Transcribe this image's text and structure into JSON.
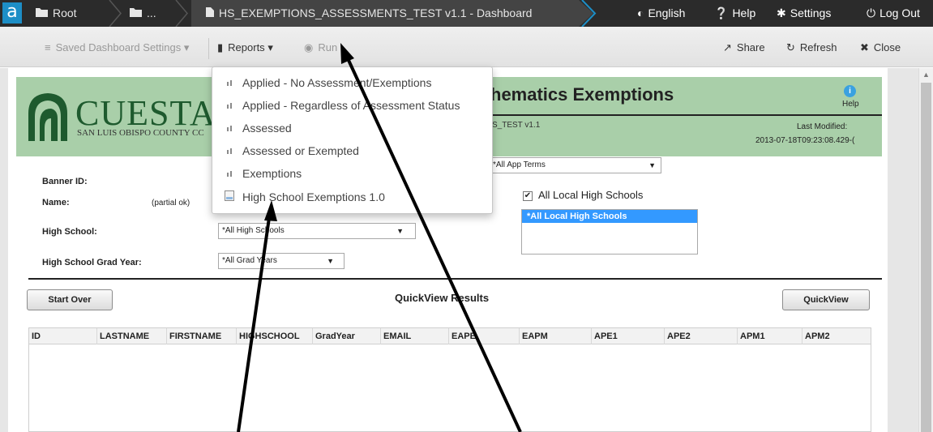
{
  "navbar": {
    "logo": "a",
    "breadcrumbs": [
      {
        "label": "Root",
        "icon": "folder-icon"
      },
      {
        "label": "...",
        "icon": "folder-icon"
      },
      {
        "label": "HS_EXEMPTIONS_ASSESSMENTS_TEST v1.1 - Dashboard",
        "icon": "file-icon"
      }
    ],
    "language": "English",
    "help": "Help",
    "settings": "Settings",
    "logout": "Log Out"
  },
  "toolbar": {
    "saved_settings": "Saved Dashboard Settings",
    "reports": "Reports",
    "run": "Run",
    "share": "Share",
    "refresh": "Refresh",
    "close": "Close"
  },
  "reports_menu": {
    "items": [
      {
        "label": "Applied - No Assessment/Exemptions",
        "icon": "report-icon"
      },
      {
        "label": "Applied - Regardless of Assessment Status",
        "icon": "report-icon"
      },
      {
        "label": "Assessed",
        "icon": "report-icon"
      },
      {
        "label": "Assessed or Exempted",
        "icon": "report-icon"
      },
      {
        "label": "Exemptions",
        "icon": "report-icon"
      },
      {
        "label": "High School Exemptions 1.0",
        "icon": "document-icon"
      }
    ]
  },
  "header": {
    "brand": "CUESTA C",
    "brand_sub": "SAN LUIS OBISPO COUNTY CC",
    "title": "hematics Exemptions",
    "file_name": "S_TEST v1.1",
    "help_label": "Help",
    "last_modified_label": "Last Modified:",
    "last_modified_value": "2013-07-18T09:23:08.429-("
  },
  "form": {
    "banner_id_label": "Banner ID:",
    "name_label": "Name:",
    "name_hint": "(partial ok)",
    "app_terms_value": "*All App Terms",
    "high_school_label": "High School:",
    "high_school_value": "*All High Schools",
    "grad_year_label": "High School Grad Year:",
    "grad_year_value": "*All Grad Years",
    "all_local_checkbox": "All Local High Schools",
    "all_local_selected": "*All Local High Schools"
  },
  "results": {
    "start_over": "Start Over",
    "title": "QuickView Results",
    "quickview": "QuickView",
    "columns": [
      "ID",
      "LASTNAME",
      "FIRSTNAME",
      "HIGHSCHOOL",
      "GradYear",
      "EMAIL",
      "EAPE",
      "EAPM",
      "APE1",
      "APE2",
      "APM1",
      "APM2"
    ]
  },
  "colors": {
    "navbar": "#2b2b2b",
    "logo_blue": "#1d8ec6",
    "header_green": "#a9cfa9",
    "brand_green": "#1e5a2e",
    "selection_blue": "#3399ff"
  }
}
